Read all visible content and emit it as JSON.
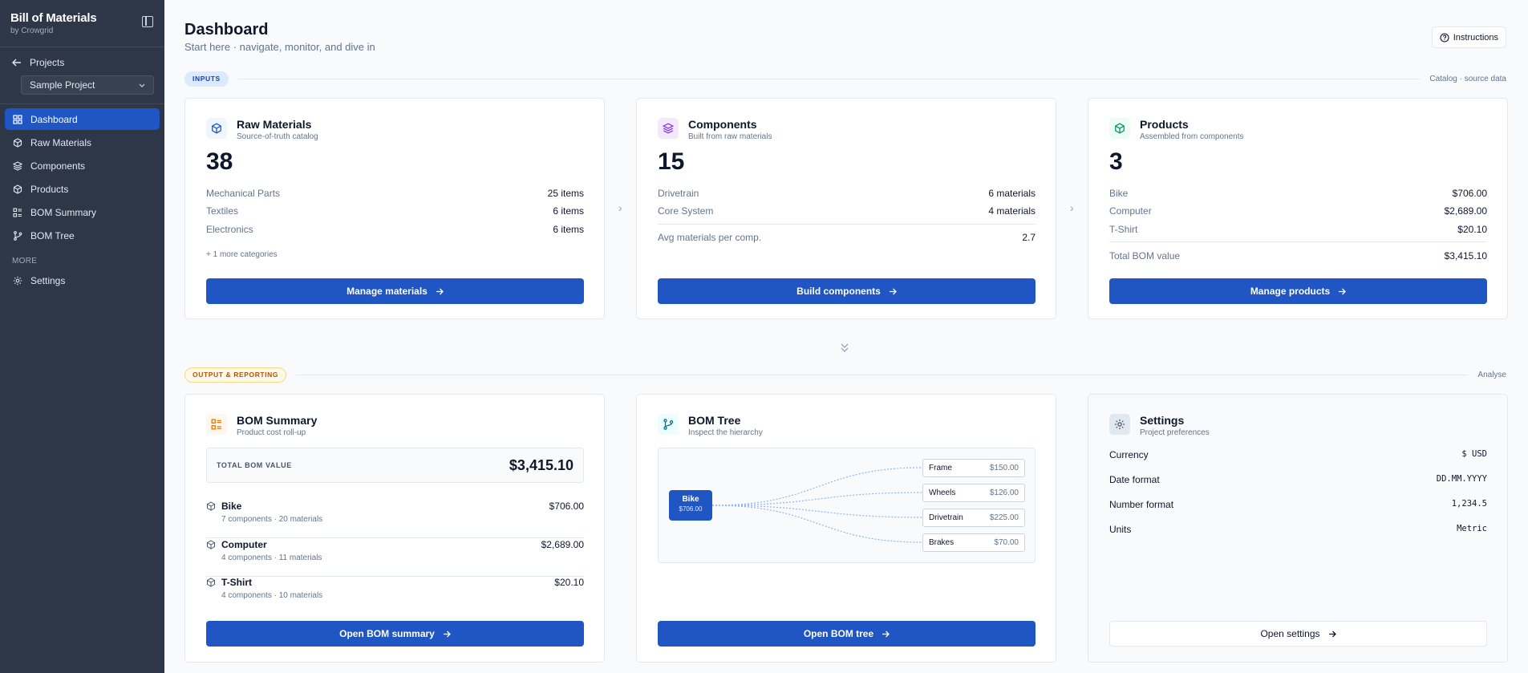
{
  "sidebar": {
    "brand_title": "Bill of Materials",
    "brand_sub": "by Crowgrid",
    "projects_label": "Projects",
    "project_selected": "Sample Project",
    "nav": [
      {
        "label": "Dashboard",
        "icon": "grid-icon"
      },
      {
        "label": "Raw Materials",
        "icon": "box-icon"
      },
      {
        "label": "Components",
        "icon": "layers-icon"
      },
      {
        "label": "Products",
        "icon": "package-icon"
      },
      {
        "label": "BOM Summary",
        "icon": "list-icon"
      },
      {
        "label": "BOM Tree",
        "icon": "branch-icon"
      }
    ],
    "more_label": "MORE",
    "settings_label": "Settings"
  },
  "header": {
    "title": "Dashboard",
    "subtitle": "Start here · navigate, monitor, and dive in",
    "instructions_label": "Instructions"
  },
  "inputs_section": {
    "pill": "INPUTS",
    "right": "Catalog · source data"
  },
  "output_section": {
    "pill": "OUTPUT & REPORTING",
    "right": "Analyse"
  },
  "raw_materials": {
    "title": "Raw Materials",
    "subtitle": "Source-of-truth catalog",
    "count": "38",
    "rows": [
      {
        "k": "Mechanical Parts",
        "v": "25 items"
      },
      {
        "k": "Textiles",
        "v": "6 items"
      },
      {
        "k": "Electronics",
        "v": "6 items"
      }
    ],
    "more": "+ 1 more categories",
    "button": "Manage materials"
  },
  "components": {
    "title": "Components",
    "subtitle": "Built from raw materials",
    "count": "15",
    "rows": [
      {
        "k": "Drivetrain",
        "v": "6 materials"
      },
      {
        "k": "Core System",
        "v": "4 materials"
      }
    ],
    "avg": {
      "k": "Avg materials per comp.",
      "v": "2.7"
    },
    "button": "Build components"
  },
  "products": {
    "title": "Products",
    "subtitle": "Assembled from components",
    "count": "3",
    "rows": [
      {
        "k": "Bike",
        "v": "$706.00"
      },
      {
        "k": "Computer",
        "v": "$2,689.00"
      },
      {
        "k": "T-Shirt",
        "v": "$20.10"
      }
    ],
    "total": {
      "k": "Total BOM value",
      "v": "$3,415.10"
    },
    "button": "Manage products"
  },
  "bom_summary": {
    "title": "BOM Summary",
    "subtitle": "Product cost roll-up",
    "total_label": "TOTAL BOM VALUE",
    "total_value": "$3,415.10",
    "items": [
      {
        "name": "Bike",
        "meta": "7 components · 20 materials",
        "price": "$706.00"
      },
      {
        "name": "Computer",
        "meta": "4 components · 11 materials",
        "price": "$2,689.00"
      },
      {
        "name": "T-Shirt",
        "meta": "4 components · 10 materials",
        "price": "$20.10"
      }
    ],
    "button": "Open BOM summary"
  },
  "bom_tree": {
    "title": "BOM Tree",
    "subtitle": "Inspect the hierarchy",
    "root": {
      "name": "Bike",
      "price": "$706.00"
    },
    "leaves": [
      {
        "name": "Frame",
        "price": "$150.00"
      },
      {
        "name": "Wheels",
        "price": "$126.00"
      },
      {
        "name": "Drivetrain",
        "price": "$225.00"
      },
      {
        "name": "Brakes",
        "price": "$70.00"
      }
    ],
    "button": "Open BOM tree"
  },
  "settings": {
    "title": "Settings",
    "subtitle": "Project preferences",
    "rows": [
      {
        "k": "Currency",
        "v": "$ USD"
      },
      {
        "k": "Date format",
        "v": "DD.MM.YYYY"
      },
      {
        "k": "Number format",
        "v": "1,234.5"
      },
      {
        "k": "Units",
        "v": "Metric"
      }
    ],
    "button": "Open settings"
  },
  "colors": {
    "sidebar_bg": "#2d3748",
    "accent": "#1f56c4",
    "page_bg": "#f8fafc"
  }
}
